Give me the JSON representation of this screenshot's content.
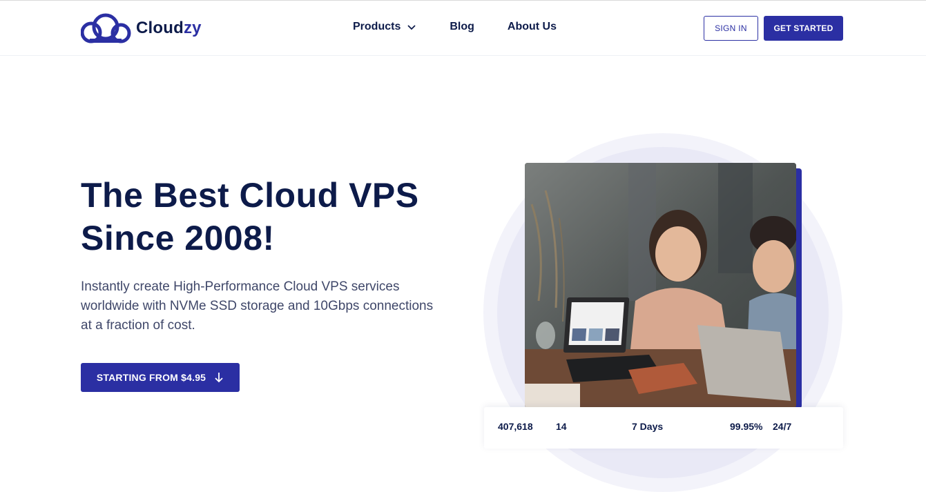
{
  "brand": {
    "name_part1": "Cloud",
    "name_part2": "zy",
    "primary_color": "#2b2fa3",
    "text_color": "#0d1b4a"
  },
  "nav": {
    "items": [
      {
        "label": "Products",
        "has_dropdown": true
      },
      {
        "label": "Blog"
      },
      {
        "label": "About Us"
      }
    ]
  },
  "header_actions": {
    "signin_label": "SIGN IN",
    "getstarted_label": "GET STARTED"
  },
  "hero": {
    "title_line1": "The Best Cloud VPS",
    "title_line2": "Since 2008!",
    "subtitle": "Instantly create High-Performance Cloud VPS services worldwide with NVMe SSD storage and 10Gbps connections at a fraction of cost.",
    "cta_label": "STARTING FROM $4.95",
    "image_icon": "people-working-with-laptops-photo"
  },
  "stats": [
    {
      "value": "407,618"
    },
    {
      "value": "14"
    },
    {
      "value": "7 Days"
    },
    {
      "value": "99.95%"
    },
    {
      "value": "24/7"
    }
  ]
}
